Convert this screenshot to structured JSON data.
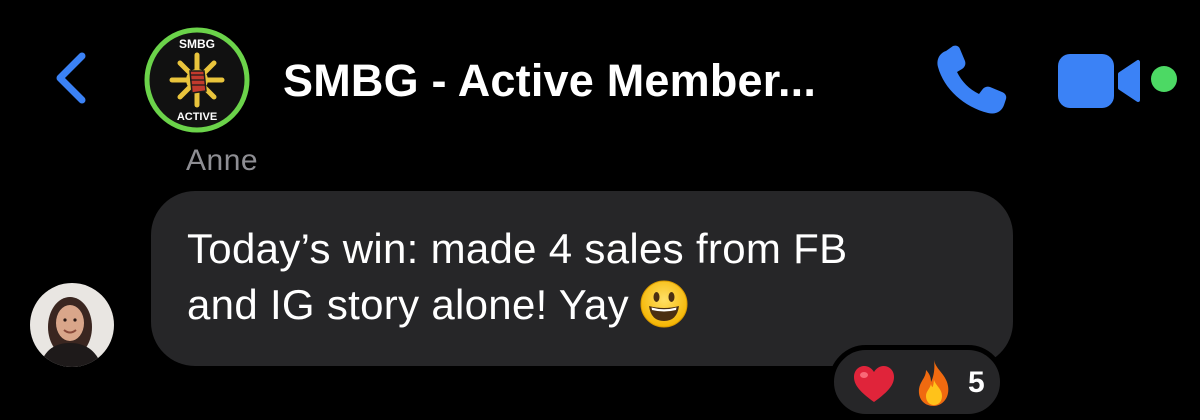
{
  "header": {
    "group_name": "SMBG - Active Member...",
    "logo_text_top": "SMBG",
    "logo_text_bottom": "ACTIVE",
    "back_icon": "chevron-left-icon",
    "call_icon": "phone-icon",
    "video_icon": "video-camera-icon",
    "online_indicator": "active-status-dot"
  },
  "message": {
    "sender": "Anne",
    "lines": [
      "Today’s win: made 4 sales from FB",
      "and IG story alone! Yay"
    ],
    "emoji": "grinning-face-emoji"
  },
  "reactions": {
    "items": [
      "heart-emoji",
      "fire-emoji"
    ],
    "count": "5"
  },
  "colors": {
    "accent": "#3b82f6",
    "online": "#4cd964",
    "background": "#000000",
    "bubble": "#262628",
    "sender_name": "#8e8e93",
    "logo_ring": "#6bd34a"
  }
}
